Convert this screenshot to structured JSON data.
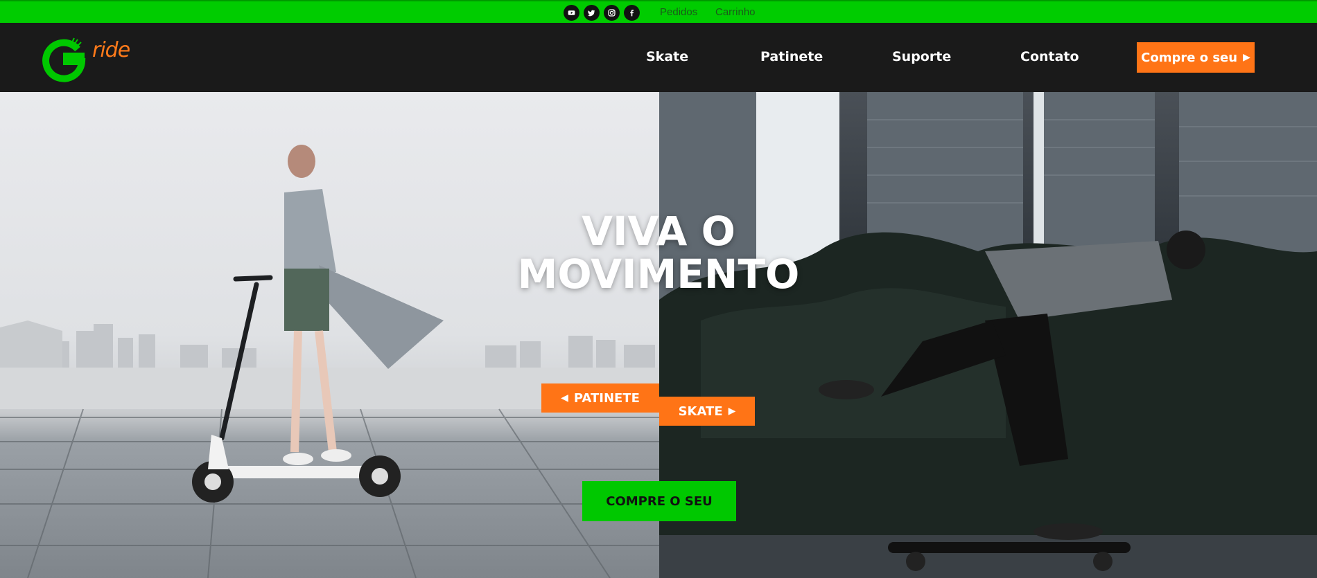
{
  "topbar": {
    "social": [
      {
        "icon": "youtube-icon"
      },
      {
        "icon": "twitter-icon"
      },
      {
        "icon": "instagram-icon"
      },
      {
        "icon": "facebook-icon"
      }
    ],
    "links": {
      "orders": "Pedidos",
      "cart": "Carrinho"
    }
  },
  "header": {
    "logo_text": "ride",
    "nav": [
      "Skate",
      "Patinete",
      "Suporte",
      "Contato"
    ],
    "cta_label": "Compre o seu",
    "cta_arrow": "▶"
  },
  "hero": {
    "headline_line1": "VIVA O",
    "headline_line2": "MOVIMENTO",
    "left_button": {
      "arrow": "◀",
      "label": "PATINETE"
    },
    "right_button": {
      "label": "SKATE",
      "arrow": "▶"
    },
    "buy_button": "COMPRE O SEU"
  },
  "colors": {
    "brand_green": "#00cc00",
    "accent_orange": "#ff7416",
    "header_bg": "#1a1a1a"
  }
}
